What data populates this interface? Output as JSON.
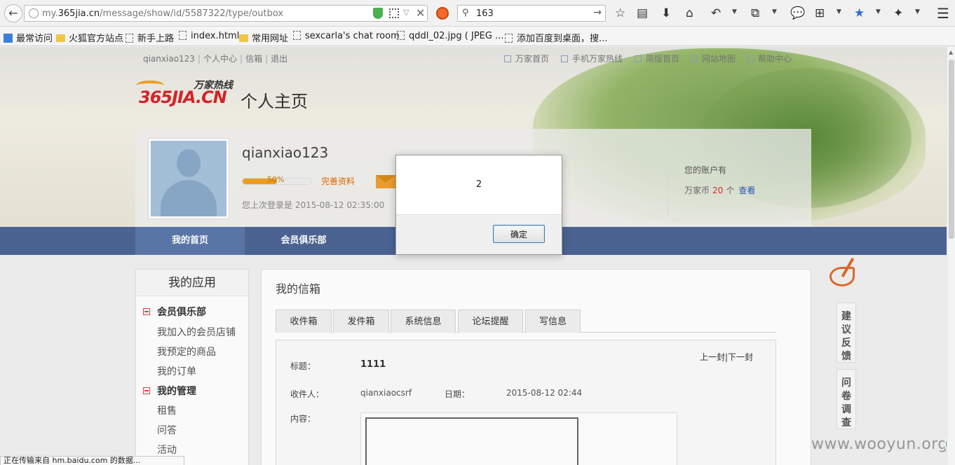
{
  "browser": {
    "url_prefix": "my.",
    "url_domain": "365jia.cn",
    "url_path": "/message/show/id/5587322/type/outbox",
    "search_value": "163",
    "status_text": "正在传输来自 hm.baidu.com 的数据..."
  },
  "bookmarks": [
    {
      "label": "最常访问",
      "icon": "special"
    },
    {
      "label": "火狐官方站点",
      "icon": "folder"
    },
    {
      "label": "新手上路",
      "icon": "page"
    },
    {
      "label": "index.html",
      "icon": "page"
    },
    {
      "label": "常用网址",
      "icon": "folder"
    },
    {
      "label": "sexcarla's chat room",
      "icon": "page"
    },
    {
      "label": "qddl_02.jpg ( JPEG ...",
      "icon": "page"
    },
    {
      "label": "添加百度到桌面，搜...",
      "icon": "page"
    }
  ],
  "topnav": {
    "username": "qianxiao123",
    "personal_center": "个人中心",
    "mailbox": "信箱",
    "logout": "退出",
    "right": [
      "万家首页",
      "手机万家热线",
      "简版首页",
      "网站地图",
      "帮助中心"
    ]
  },
  "logo": {
    "main": "365JIA.CN",
    "sub": "万家热线"
  },
  "page_heading": "个人主页",
  "profile": {
    "username": "qianxiao123",
    "progress_text": "50%",
    "progress_value": 0.5,
    "complete_link": "完善资料",
    "last_login": "您上次登录是 2015-08-12 02:35:00",
    "account_title": "您的账户有",
    "coin_label": "万家币",
    "coin_count": "20",
    "coin_unit": "个",
    "view_link": "查看"
  },
  "mainnav": [
    "我的首页",
    "会员俱乐部"
  ],
  "sidebar": {
    "title": "我的应用",
    "group1": "会员俱乐部",
    "group1_items": [
      "我加入的会员店铺",
      "我预定的商品",
      "我的订单"
    ],
    "group2": "我的管理",
    "group2_items": [
      "租售",
      "问答",
      "活动"
    ]
  },
  "content": {
    "title": "我的信箱",
    "tabs": [
      "收件箱",
      "发件箱",
      "系统信息",
      "论坛提醒",
      "写信息"
    ],
    "subject_label": "标题：",
    "subject_value": "1111",
    "nav": "上一封|下一封",
    "recipient_label": "收件人：",
    "recipient_value": "qianxiaocsrf",
    "date_label": "日期：",
    "date_value": "2015-08-12 02:44",
    "body_label": "内容："
  },
  "side_tabs": [
    "建议反馈",
    "问卷调查"
  ],
  "watermark": "www.wooyun.org",
  "dialog": {
    "message": "2",
    "ok_label": "确定"
  }
}
